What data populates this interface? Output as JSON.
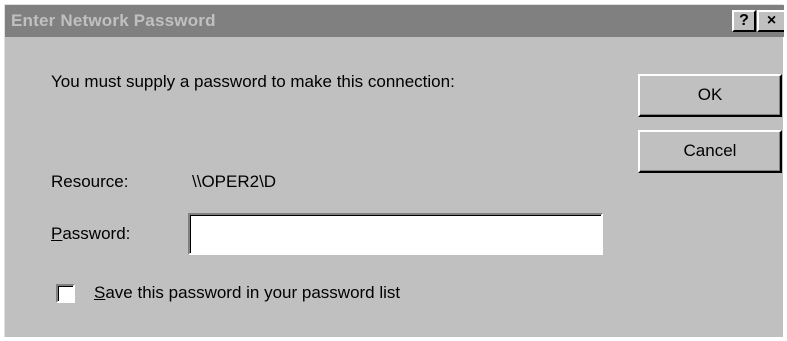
{
  "dialog": {
    "title": "Enter Network Password",
    "help_label": "?",
    "close_label": "×",
    "prompt": "You must supply a password to make this connection:",
    "resource_label": "Resource:",
    "resource_value": "\\\\OPER2\\D",
    "password_label_accel": "P",
    "password_label_rest": "assword:",
    "password_value": "",
    "save_accel": "S",
    "save_rest": "ave this password in your password list",
    "save_checked": false,
    "ok_label": "OK",
    "cancel_label": "Cancel"
  }
}
